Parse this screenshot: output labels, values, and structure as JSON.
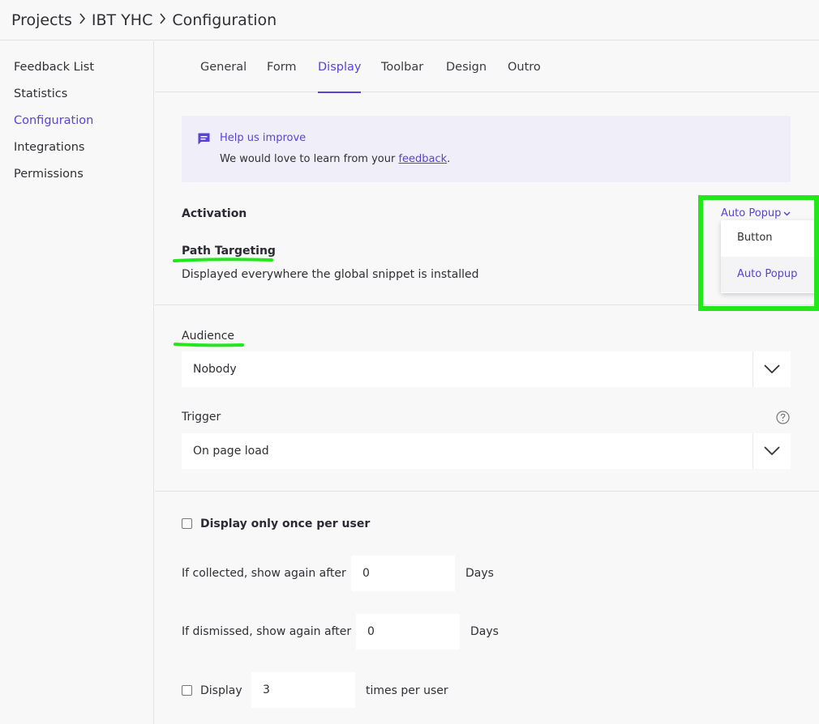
{
  "breadcrumb": {
    "items": [
      "Projects",
      "IBT YHC",
      "Configuration"
    ]
  },
  "sidebar": {
    "items": [
      {
        "label": "Feedback List"
      },
      {
        "label": "Statistics"
      },
      {
        "label": "Configuration",
        "active": true
      },
      {
        "label": "Integrations"
      },
      {
        "label": "Permissions"
      }
    ]
  },
  "tabs": [
    {
      "label": "General"
    },
    {
      "label": "Form"
    },
    {
      "label": "Display",
      "active": true
    },
    {
      "label": "Toolbar"
    },
    {
      "label": "Design"
    },
    {
      "label": "Outro"
    }
  ],
  "notice": {
    "icon": "chat-message-icon",
    "title": "Help us improve",
    "text_prefix": "We would love to learn from your ",
    "link": "feedback",
    "text_suffix": "."
  },
  "activation": {
    "title": "Activation",
    "mode_selected": "Auto Popup",
    "options": [
      "Button",
      "Auto Popup"
    ]
  },
  "path_targeting": {
    "title": "Path Targeting",
    "description": "Displayed everywhere the global snippet is installed"
  },
  "audience": {
    "label": "Audience",
    "value": "Nobody"
  },
  "trigger": {
    "label": "Trigger",
    "value": "On page load"
  },
  "frequency": {
    "display_once_label": "Display only once per user",
    "display_once_checked": false,
    "collected_label": "If collected, show again after",
    "collected_value": "0",
    "collected_unit": "Days",
    "dismissed_label": "If dismissed, show again after",
    "dismissed_value": "0",
    "dismissed_unit": "Days",
    "display_label": "Display",
    "display_checked": false,
    "display_value": "3",
    "display_unit": "times per user"
  },
  "colors": {
    "accent": "#5b42d4",
    "highlight": "#22e81b"
  }
}
